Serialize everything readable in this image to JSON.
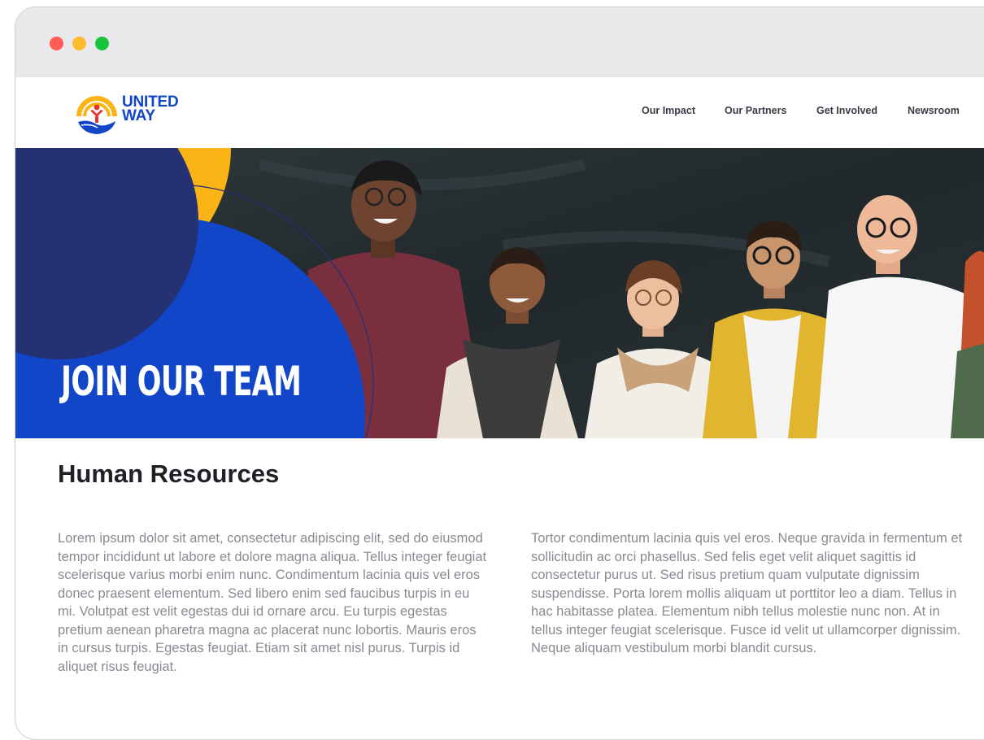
{
  "window": {
    "controls": [
      "close",
      "minimize",
      "maximize"
    ]
  },
  "brand": {
    "logo_line1": "UNITED",
    "logo_line2": "WAY",
    "logo_icon": "united-way-hand-icon",
    "colors": {
      "blue": "#1146c8",
      "navy": "#243173",
      "gold": "#fbb415",
      "red": "#e5342c"
    }
  },
  "nav": {
    "items": [
      {
        "label": "Our Impact"
      },
      {
        "label": "Our Partners"
      },
      {
        "label": "Get Involved"
      },
      {
        "label": "Newsroom"
      }
    ]
  },
  "hero": {
    "title": "JOIN OUR TEAM"
  },
  "main": {
    "title": "Human Resources",
    "paragraph1": "Lorem ipsum dolor sit amet, consectetur adipiscing elit, sed do eiusmod tempor incididunt ut labore et dolore magna aliqua. Tellus integer feugiat scelerisque varius morbi enim nunc. Condimentum lacinia quis vel eros donec praesent elementum. Sed libero enim sed faucibus turpis in eu mi. Volutpat est velit egestas dui id ornare arcu. Eu turpis egestas pretium aenean pharetra magna ac placerat nunc lobortis. Mauris eros in cursus turpis. Egestas feugiat. Etiam sit amet nisl purus. Turpis id aliquet risus feugiat.",
    "paragraph2": "Tortor condimentum lacinia quis vel eros. Neque gravida in fermentum et sollicitudin ac orci phasellus. Sed felis eget velit aliquet sagittis id consectetur purus ut. Sed risus pretium quam vulputate dignissim suspendisse. Porta lorem mollis aliquam ut porttitor leo a diam. Tellus in hac habitasse platea. Elementum nibh tellus molestie nunc non. At in tellus integer feugiat scelerisque. Fusce id velit ut ullamcorper dignissim. Neque aliquam vestibulum morbi blandit cursus."
  }
}
